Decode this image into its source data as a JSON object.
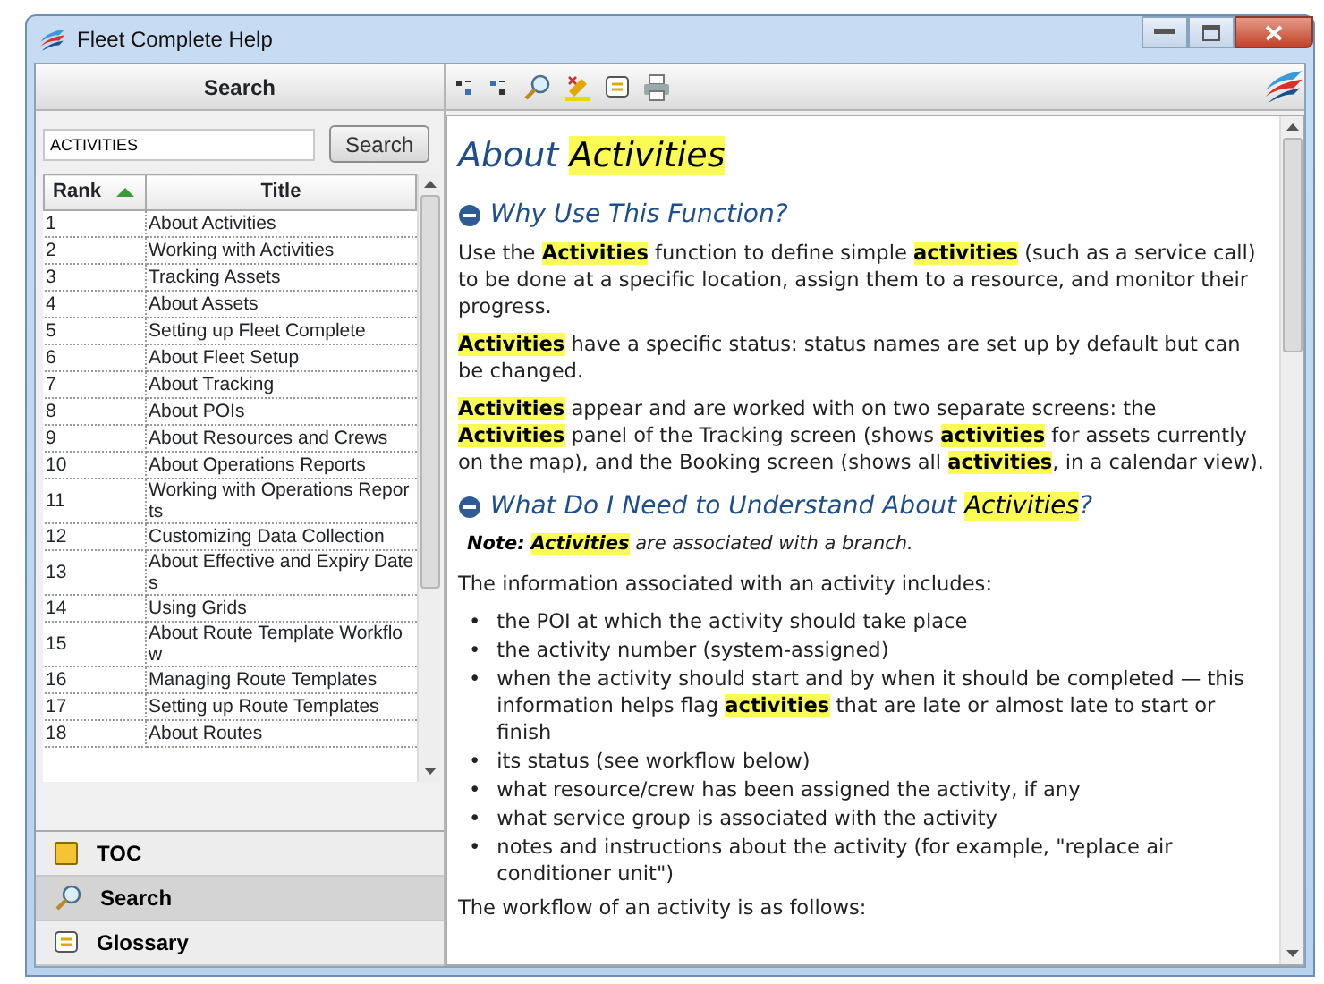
{
  "window": {
    "title": "Fleet Complete Help"
  },
  "left_pane": {
    "header": "Search",
    "search": {
      "value": "ACTIVITIES",
      "button": "Search"
    },
    "table": {
      "columns": [
        {
          "label": "Rank",
          "sorted": true
        },
        {
          "label": "Title",
          "sorted": false
        }
      ],
      "rows": [
        {
          "rank": "1",
          "title": "About Activities"
        },
        {
          "rank": "2",
          "title": "Working with Activities"
        },
        {
          "rank": "3",
          "title": "Tracking Assets"
        },
        {
          "rank": "4",
          "title": "About Assets"
        },
        {
          "rank": "5",
          "title": "Setting up Fleet Complete"
        },
        {
          "rank": "6",
          "title": "About Fleet Setup"
        },
        {
          "rank": "7",
          "title": "About Tracking"
        },
        {
          "rank": "8",
          "title": "About POIs"
        },
        {
          "rank": "9",
          "title": "About Resources and Crews"
        },
        {
          "rank": "10",
          "title": "About Operations Reports"
        },
        {
          "rank": "11",
          "title": "Working with Operations Reports"
        },
        {
          "rank": "12",
          "title": "Customizing Data Collection"
        },
        {
          "rank": "13",
          "title": "About Effective and Expiry Dates"
        },
        {
          "rank": "14",
          "title": "Using Grids"
        },
        {
          "rank": "15",
          "title": "About Route Template Workflow"
        },
        {
          "rank": "16",
          "title": "Managing Route Templates"
        },
        {
          "rank": "17",
          "title": "Setting up Route Templates"
        },
        {
          "rank": "18",
          "title": "About Routes"
        }
      ]
    },
    "nav": [
      {
        "kind": "toc",
        "label": "TOC",
        "selected": false
      },
      {
        "kind": "search",
        "label": "Search",
        "selected": true
      },
      {
        "kind": "glossary",
        "label": "Glossary",
        "selected": false
      }
    ]
  },
  "toolbar": [
    {
      "kind": "expand"
    },
    {
      "kind": "collapse"
    },
    {
      "kind": "search"
    },
    {
      "kind": "highlight"
    },
    {
      "kind": "glossary"
    },
    {
      "kind": "print"
    }
  ],
  "topic": {
    "title": "About **Activities**",
    "sections": [
      {
        "heading": "Why Use This Function?",
        "expanded": true,
        "blocks": [
          {
            "kind": "paragraph",
            "text": "Use the **Activities** function to define simple **activities** (such as a service call) to be done at a specific location, assign them to a resource, and monitor their progress."
          },
          {
            "kind": "paragraph",
            "text": "**Activities** have a specific status: status names are set up by default but can be changed."
          },
          {
            "kind": "paragraph",
            "text": "**Activities** appear and are worked with on two separate screens: the **Activities** panel of the Tracking screen (shows **activities** for assets currently on the map), and the Booking screen (shows all **activities**, in a calendar view)."
          }
        ]
      },
      {
        "heading": "What Do I Need to Understand About **Activities**?",
        "expanded": true,
        "blocks": [
          {
            "kind": "note",
            "label": "Note:",
            "text": "**Activities** are associated with a branch."
          },
          {
            "kind": "paragraph",
            "text": "The information associated with an activity includes:"
          },
          {
            "kind": "list",
            "marker": "•",
            "items": [
              "the POI at which the activity should take place",
              "the activity number (system-assigned)",
              "when the activity should start and by when it should be completed — this information helps flag **activities** that are late or almost late to start or finish",
              "its status (see workflow below)",
              "what resource/crew has been assigned the activity, if any",
              "what service group is associated with the activity",
              "notes and instructions about the activity (for example, \"replace air conditioner unit\")"
            ]
          },
          {
            "kind": "paragraph",
            "text": "The workflow of an activity is as follows:"
          }
        ]
      }
    ]
  }
}
